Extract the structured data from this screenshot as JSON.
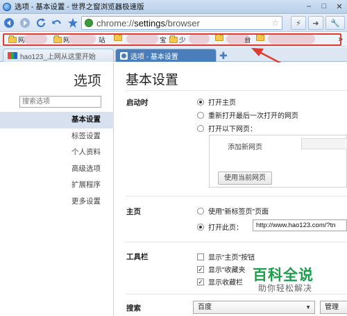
{
  "window": {
    "title": "选项 - 基本设置 - 世界之窗浏览器极速版",
    "controls": [
      "minimize-icon",
      "maximize-icon",
      "close-icon"
    ]
  },
  "toolbar": {
    "address_prefix": "chrome://",
    "address_path": "settings",
    "address_suffix": "/browser",
    "buttons": [
      "back-icon",
      "forward-icon",
      "refresh-icon",
      "undo-icon",
      "favorite-star-icon"
    ]
  },
  "bookmarks": {
    "items": [
      "网",
      "网",
      "站",
      "宝",
      "少",
      "",
      "",
      "台"
    ],
    "more": "»"
  },
  "tabs": [
    {
      "label": "hao123_上网从这里开始",
      "icon": "hao123-icon",
      "active": false
    },
    {
      "label": "选项 - 基本设置",
      "icon": "settings-wrench-icon",
      "active": true
    }
  ],
  "sidebar": {
    "title": "选项",
    "search_placeholder": "搜索选项",
    "items": [
      {
        "label": "基本设置",
        "active": true
      },
      {
        "label": "标签设置",
        "active": false
      },
      {
        "label": "个人资料",
        "active": false
      },
      {
        "label": "高级选项",
        "active": false
      },
      {
        "label": "扩展程序",
        "active": false
      },
      {
        "label": "更多设置",
        "active": false
      }
    ]
  },
  "main": {
    "title": "基本设置",
    "startup": {
      "label": "启动时",
      "options": [
        "打开主页",
        "重新打开最后一次打开的网页",
        "打开以下网页："
      ],
      "selected": 0,
      "add_page": "添加新网页",
      "use_current": "使用当前网页"
    },
    "homepage": {
      "label": "主页",
      "options": [
        "使用\"新标签页\"页面",
        "打开此页："
      ],
      "selected": 1,
      "url": "http://www.hao123.com/?tn"
    },
    "toolbar_section": {
      "label": "工具栏",
      "checks": [
        {
          "label": "显示\"主页\"按钮",
          "checked": false
        },
        {
          "label": "显示\"收藏夹",
          "checked": true
        },
        {
          "label": "显示收藏栏",
          "checked": true
        }
      ]
    },
    "search": {
      "label": "搜索",
      "engine": "百度",
      "manage": "管理"
    }
  },
  "watermark": {
    "title": "百科全说",
    "subtitle": "助你轻松解决"
  },
  "colors": {
    "accent": "#4a7ebb",
    "highlight": "#e03c31",
    "watermark": "#1a9f49"
  }
}
